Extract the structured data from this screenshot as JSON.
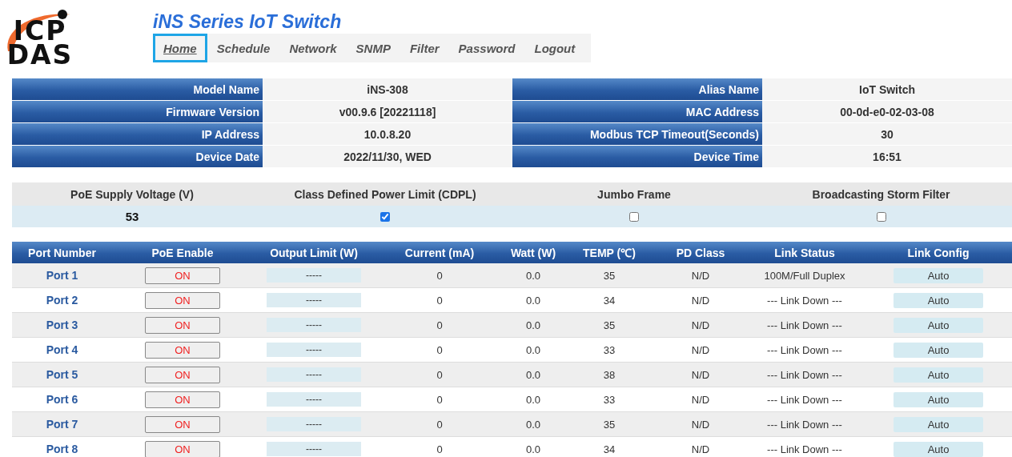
{
  "logo": {
    "line1": "ICP",
    "line2": "DAS"
  },
  "title": "iNS Series IoT Switch",
  "nav": [
    {
      "label": "Home",
      "selected": true
    },
    {
      "label": "Schedule",
      "selected": false
    },
    {
      "label": "Network",
      "selected": false
    },
    {
      "label": "SNMP",
      "selected": false
    },
    {
      "label": "Filter",
      "selected": false
    },
    {
      "label": "Password",
      "selected": false
    },
    {
      "label": "Logout",
      "selected": false
    }
  ],
  "info": [
    {
      "left_label": "Model Name",
      "left_value": "iNS-308",
      "right_label": "Alias Name",
      "right_value": "IoT Switch"
    },
    {
      "left_label": "Firmware Version",
      "left_value": "v00.9.6 [20221118]",
      "right_label": "MAC Address",
      "right_value": "00-0d-e0-02-03-08"
    },
    {
      "left_label": "IP Address",
      "left_value": "10.0.8.20",
      "right_label": "Modbus TCP Timeout(Seconds)",
      "right_value": "30"
    },
    {
      "left_label": "Device Date",
      "left_value": "2022/11/30, WED",
      "right_label": "Device Time",
      "right_value": "16:51"
    }
  ],
  "settings": [
    {
      "label": "PoE Supply Voltage (V)",
      "kind": "text",
      "value": "53"
    },
    {
      "label": "Class Defined Power Limit (CDPL)",
      "kind": "checkbox",
      "checked": true
    },
    {
      "label": "Jumbo Frame",
      "kind": "checkbox",
      "checked": false
    },
    {
      "label": "Broadcasting Storm Filter",
      "kind": "checkbox",
      "checked": false
    }
  ],
  "ports": {
    "columns": [
      "Port Number",
      "PoE Enable",
      "Output Limit (W)",
      "Current (mA)",
      "Watt (W)",
      "TEMP (℃)",
      "PD Class",
      "Link Status",
      "Link Config"
    ],
    "rows": [
      {
        "port": "Port 1",
        "poe": "ON",
        "output_limit": "-----",
        "current": "0",
        "watt": "0.0",
        "temp": "35",
        "pd_class": "N/D",
        "link_status": "100M/Full Duplex",
        "link_config": "Auto"
      },
      {
        "port": "Port 2",
        "poe": "ON",
        "output_limit": "-----",
        "current": "0",
        "watt": "0.0",
        "temp": "34",
        "pd_class": "N/D",
        "link_status": "--- Link Down ---",
        "link_config": "Auto"
      },
      {
        "port": "Port 3",
        "poe": "ON",
        "output_limit": "-----",
        "current": "0",
        "watt": "0.0",
        "temp": "35",
        "pd_class": "N/D",
        "link_status": "--- Link Down ---",
        "link_config": "Auto"
      },
      {
        "port": "Port 4",
        "poe": "ON",
        "output_limit": "-----",
        "current": "0",
        "watt": "0.0",
        "temp": "33",
        "pd_class": "N/D",
        "link_status": "--- Link Down ---",
        "link_config": "Auto"
      },
      {
        "port": "Port 5",
        "poe": "ON",
        "output_limit": "-----",
        "current": "0",
        "watt": "0.0",
        "temp": "38",
        "pd_class": "N/D",
        "link_status": "--- Link Down ---",
        "link_config": "Auto"
      },
      {
        "port": "Port 6",
        "poe": "ON",
        "output_limit": "-----",
        "current": "0",
        "watt": "0.0",
        "temp": "33",
        "pd_class": "N/D",
        "link_status": "--- Link Down ---",
        "link_config": "Auto"
      },
      {
        "port": "Port 7",
        "poe": "ON",
        "output_limit": "-----",
        "current": "0",
        "watt": "0.0",
        "temp": "35",
        "pd_class": "N/D",
        "link_status": "--- Link Down ---",
        "link_config": "Auto"
      },
      {
        "port": "Port 8",
        "poe": "ON",
        "output_limit": "-----",
        "current": "0",
        "watt": "0.0",
        "temp": "34",
        "pd_class": "N/D",
        "link_status": "--- Link Down ---",
        "link_config": "Auto"
      }
    ]
  }
}
